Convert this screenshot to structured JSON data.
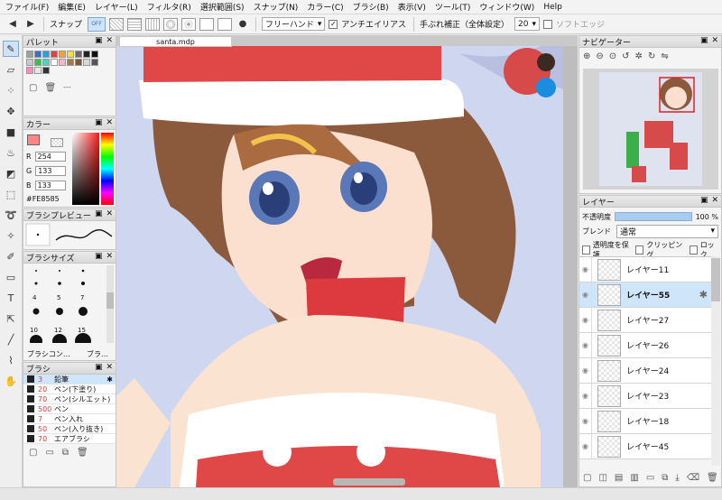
{
  "menu": [
    "ファイル(F)",
    "編集(E)",
    "レイヤー(L)",
    "フィルタ(R)",
    "選択範囲(S)",
    "スナップ(N)",
    "カラー(C)",
    "ブラシ(B)",
    "表示(V)",
    "ツール(T)",
    "ウィンドウ(W)",
    "Help"
  ],
  "toolbar": {
    "snap_label": "スナップ",
    "snap_off": "OFF",
    "brush_mode": "フリーハンド",
    "antialias": "アンチエイリアス",
    "stabilizer_label": "手ぶれ補正（全体設定）",
    "stabilizer_value": "20",
    "soft_edge": "ソフトエッジ"
  },
  "document": {
    "tab": "santa.mdp"
  },
  "palette": {
    "title": "パレット",
    "colors": [
      "#9aa0a6",
      "#3a6bd6",
      "#2e9ee6",
      "#e83e3e",
      "#f2a22e",
      "#f2e23a",
      "#6a6a6a",
      "#222222",
      "#111111",
      "#c9c9c9",
      "#3cbf4a",
      "#46d6c6",
      "#ffffff",
      "#f6b8c8",
      "#a87848",
      "#7a5a3a",
      "#d8d8d8",
      "#555555",
      "#ff8ac0",
      "#e8e8e8",
      "#333333"
    ],
    "blank_hint": "---"
  },
  "color": {
    "title": "カラー",
    "r": "254",
    "g": "133",
    "b": "133",
    "hex": "#FE8585",
    "current": "#fe8585"
  },
  "brush_preview": {
    "title": "ブラシプレビュー"
  },
  "brush_size": {
    "title": "ブラシサイズ",
    "labels": [
      "4",
      "5",
      "7",
      "10",
      "12",
      "15"
    ],
    "btn_a": "ブラシコン…",
    "btn_b": "ブラ…"
  },
  "brush": {
    "title": "ブラシ",
    "items": [
      {
        "size": "3",
        "name": "鉛筆"
      },
      {
        "size": "20",
        "name": "ペン(下塗り)"
      },
      {
        "size": "70",
        "name": "ペン(シルエット)"
      },
      {
        "size": "500",
        "name": "ペン"
      },
      {
        "size": "7",
        "name": "ペン入れ"
      },
      {
        "size": "50",
        "name": "ペン(入り抜き)"
      },
      {
        "size": "70",
        "name": "エアブラシ"
      }
    ]
  },
  "navigator": {
    "title": "ナビゲーター"
  },
  "layer": {
    "title": "レイヤー",
    "opacity_label": "不透明度",
    "opacity_value": "100 %",
    "opacity": 1.0,
    "blend_label": "ブレンド",
    "blend_value": "通常",
    "protect": "透明度を保護",
    "clipping": "クリッピング",
    "lock": "ロック",
    "items": [
      "レイヤー11",
      "レイヤー55",
      "レイヤー27",
      "レイヤー26",
      "レイヤー24",
      "レイヤー23",
      "レイヤー18",
      "レイヤー45"
    ]
  }
}
